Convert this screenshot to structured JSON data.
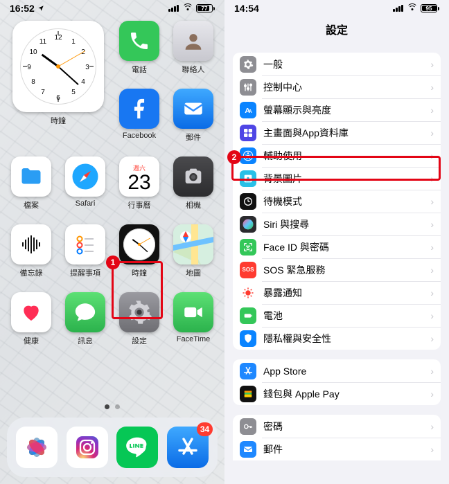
{
  "left": {
    "status": {
      "time": "16:52",
      "battery": "77"
    },
    "callout_num": "1",
    "widget_label": "時鐘",
    "apps_row1": [
      {
        "name": "phone",
        "label": "電話",
        "bg": "#34c759"
      },
      {
        "name": "contacts",
        "label": "聯絡人",
        "bg": "#d9d9de"
      }
    ],
    "apps_row2": [
      {
        "name": "facebook",
        "label": "Facebook",
        "bg": "#1877f2"
      },
      {
        "name": "mail",
        "label": "郵件",
        "bg": "#1e88ff"
      }
    ],
    "apps_row3": [
      {
        "name": "files",
        "label": "檔案",
        "bg": "#ffffff"
      },
      {
        "name": "safari",
        "label": "Safari",
        "bg": "#ffffff"
      },
      {
        "name": "calendar",
        "label": "行事曆",
        "top": "週六",
        "day": "23",
        "bg": "#ffffff"
      },
      {
        "name": "camera",
        "label": "相機",
        "bg": "#3a3a3c"
      }
    ],
    "apps_row4": [
      {
        "name": "voicememo",
        "label": "備忘錄",
        "bg": "#ffffff"
      },
      {
        "name": "reminders",
        "label": "提醒事項",
        "bg": "#ffffff"
      },
      {
        "name": "clock",
        "label": "時鐘",
        "bg": "#111111"
      },
      {
        "name": "maps",
        "label": "地圖",
        "bg": "#eaf7ec"
      }
    ],
    "apps_row5": [
      {
        "name": "health",
        "label": "健康",
        "bg": "#ffffff"
      },
      {
        "name": "messages",
        "label": "訊息",
        "bg": "#34c759"
      },
      {
        "name": "settings",
        "label": "設定",
        "bg": "#8e8e93"
      },
      {
        "name": "facetime",
        "label": "FaceTime",
        "bg": "#34c759"
      }
    ],
    "dock": [
      {
        "name": "photos",
        "bg": "#ffffff"
      },
      {
        "name": "instagram",
        "bg": "#ffffff"
      },
      {
        "name": "line",
        "bg": "#06c755"
      },
      {
        "name": "appstore",
        "bg": "#1e88ff",
        "badge": "34"
      }
    ]
  },
  "right": {
    "status": {
      "time": "14:54",
      "battery": "95"
    },
    "title": "設定",
    "callout_num": "2",
    "group1": [
      {
        "name": "general",
        "label": "一般",
        "bg": "#8e8e93"
      },
      {
        "name": "controlcenter",
        "label": "控制中心",
        "bg": "#8e8e93"
      },
      {
        "name": "display",
        "label": "螢幕顯示與亮度",
        "bg": "#0a84ff"
      },
      {
        "name": "homescreen",
        "label": "主畫面與App資料庫",
        "bg": "#4f46e5"
      },
      {
        "name": "accessibility",
        "label": "輔助使用",
        "bg": "#0a84ff"
      },
      {
        "name": "wallpaper",
        "label": "背景圖片",
        "bg": "#29c0e7"
      },
      {
        "name": "standby",
        "label": "待機模式",
        "bg": "#111111"
      },
      {
        "name": "siri",
        "label": "Siri 與搜尋",
        "bg": "#2b2b2e"
      },
      {
        "name": "faceid",
        "label": "Face ID 與密碼",
        "bg": "#34c759"
      },
      {
        "name": "sos",
        "label": "SOS 緊急服務",
        "bg": "#ff3b30",
        "text": "SOS"
      },
      {
        "name": "exposure",
        "label": "暴露通知",
        "bg": "#ffffff"
      },
      {
        "name": "battery",
        "label": "電池",
        "bg": "#34c759"
      },
      {
        "name": "privacy",
        "label": "隱私權與安全性",
        "bg": "#0a84ff"
      }
    ],
    "group2": [
      {
        "name": "appstore",
        "label": "App Store",
        "bg": "#1e88ff"
      },
      {
        "name": "wallet",
        "label": "錢包與 Apple Pay",
        "bg": "#111111"
      }
    ],
    "group3": [
      {
        "name": "passwords",
        "label": "密碼",
        "bg": "#8e8e93"
      },
      {
        "name": "mail",
        "label": "郵件",
        "bg": "#1e88ff"
      }
    ]
  }
}
